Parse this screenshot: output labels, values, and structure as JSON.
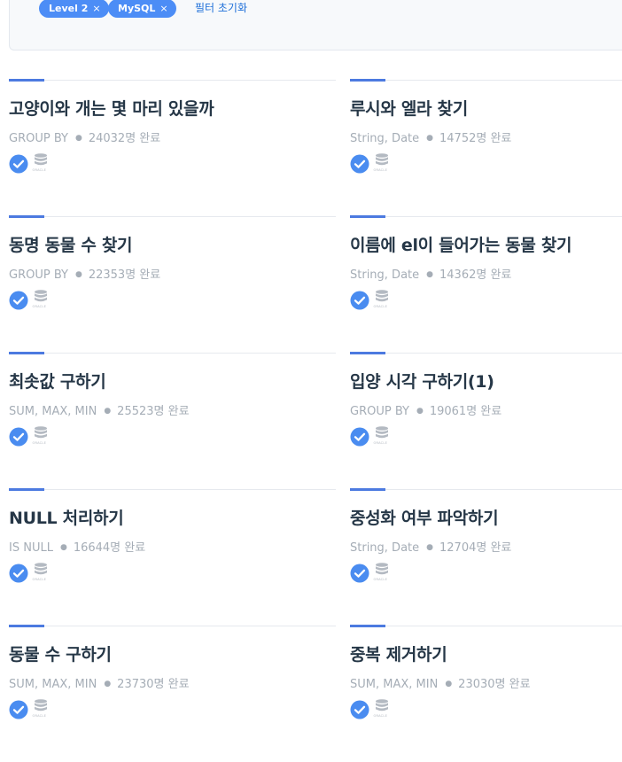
{
  "filters": {
    "chips": [
      {
        "label": "Level 2",
        "remove": "×"
      },
      {
        "label": "MySQL",
        "remove": "×"
      }
    ],
    "reset_label": "필터 초기화"
  },
  "colors": {
    "accent": "#4c7ae0",
    "chip": "#4c8df6",
    "check": "#4a8cf0",
    "link": "#1e6fd9"
  },
  "cards": [
    {
      "title": "고양이와 개는 몇 마리 있을까",
      "category": "GROUP BY",
      "completed": "24032명 완료",
      "icons": [
        "solved-check-icon",
        "oracle-database-icon"
      ]
    },
    {
      "title": "루시와 엘라 찾기",
      "category": "String, Date",
      "completed": "14752명 완료",
      "icons": [
        "solved-check-icon",
        "oracle-database-icon"
      ]
    },
    {
      "title": "동명 동물 수 찾기",
      "category": "GROUP BY",
      "completed": "22353명 완료",
      "icons": [
        "solved-check-icon",
        "oracle-database-icon"
      ]
    },
    {
      "title": "이름에 el이 들어가는 동물 찾기",
      "category": "String, Date",
      "completed": "14362명 완료",
      "icons": [
        "solved-check-icon",
        "oracle-database-icon"
      ]
    },
    {
      "title": "최솟값 구하기",
      "category": "SUM, MAX, MIN",
      "completed": "25523명 완료",
      "icons": [
        "solved-check-icon",
        "oracle-database-icon"
      ]
    },
    {
      "title": "입양 시각 구하기(1)",
      "category": "GROUP BY",
      "completed": "19061명 완료",
      "icons": [
        "solved-check-icon",
        "oracle-database-icon"
      ]
    },
    {
      "title": "NULL 처리하기",
      "category": "IS NULL",
      "completed": "16644명 완료",
      "icons": [
        "solved-check-icon",
        "oracle-database-icon"
      ]
    },
    {
      "title": "중성화 여부 파악하기",
      "category": "String, Date",
      "completed": "12704명 완료",
      "icons": [
        "solved-check-icon",
        "oracle-database-icon"
      ]
    },
    {
      "title": "동물 수 구하기",
      "category": "SUM, MAX, MIN",
      "completed": "23730명 완료",
      "icons": [
        "solved-check-icon",
        "oracle-database-icon"
      ]
    },
    {
      "title": "중복 제거하기",
      "category": "SUM, MAX, MIN",
      "completed": "23030명 완료",
      "icons": [
        "solved-check-icon",
        "oracle-database-icon"
      ]
    }
  ]
}
